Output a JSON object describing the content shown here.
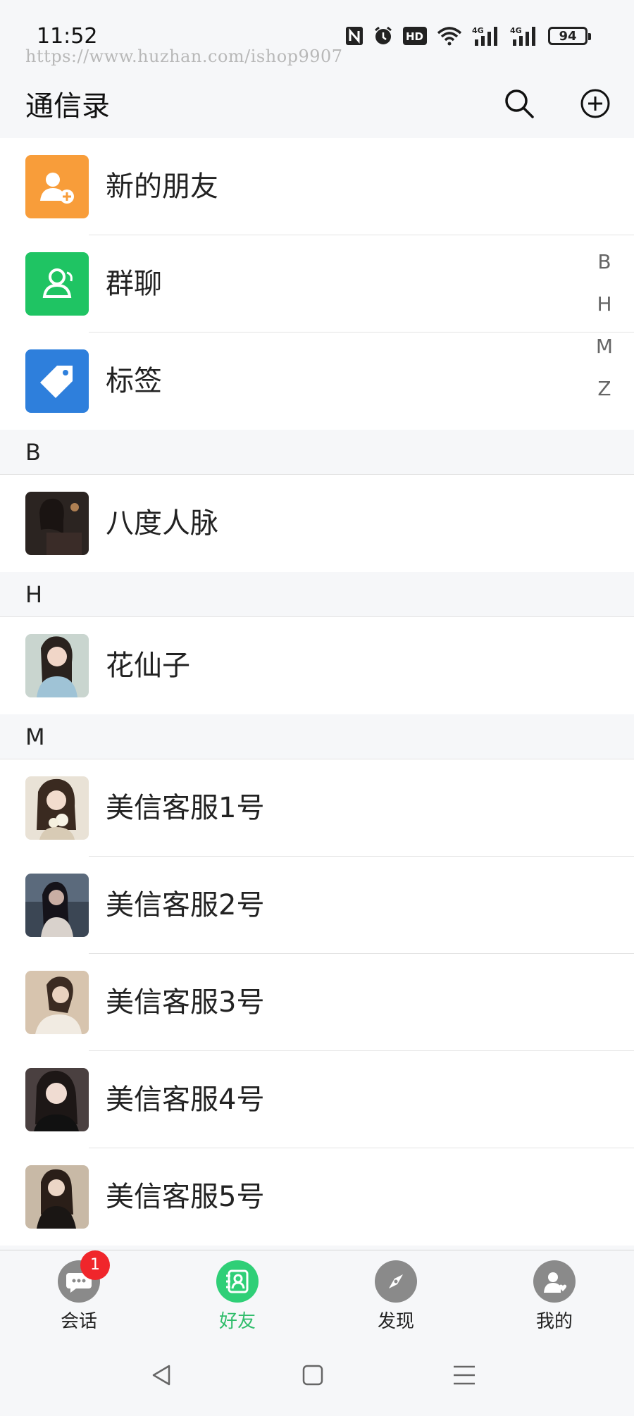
{
  "status": {
    "time": "11:52",
    "battery": "94",
    "watermark": "https://www.huzhan.com/ishop9907",
    "icons": [
      "nfc-icon",
      "alarm-icon",
      "hd-icon",
      "wifi-icon",
      "4g-signal-icon",
      "4g-signal-icon",
      "battery-icon"
    ]
  },
  "header": {
    "title": "通信录",
    "search_icon": "search-icon",
    "add_icon": "add-circle-icon"
  },
  "functions": [
    {
      "label": "新的朋友",
      "icon": "add-user-icon",
      "color": "#f89d3a"
    },
    {
      "label": "群聊",
      "icon": "group-icon",
      "color": "#1fc463"
    },
    {
      "label": "标签",
      "icon": "tag-icon",
      "color": "#2e7fdc"
    }
  ],
  "sections": [
    {
      "letter": "B",
      "contacts": [
        {
          "name": "八度人脉"
        }
      ]
    },
    {
      "letter": "H",
      "contacts": [
        {
          "name": "花仙子"
        }
      ]
    },
    {
      "letter": "M",
      "contacts": [
        {
          "name": "美信客服1号"
        },
        {
          "name": "美信客服2号"
        },
        {
          "name": "美信客服3号"
        },
        {
          "name": "美信客服4号"
        },
        {
          "name": "美信客服5号"
        }
      ]
    }
  ],
  "index_letters": [
    "B",
    "H",
    "M",
    "Z"
  ],
  "tabs": [
    {
      "label": "会话",
      "icon": "chat-icon",
      "badge": "1",
      "active": false
    },
    {
      "label": "好友",
      "icon": "contacts-icon",
      "active": true
    },
    {
      "label": "发现",
      "icon": "compass-icon",
      "active": false
    },
    {
      "label": "我的",
      "icon": "profile-icon",
      "active": false
    }
  ],
  "colors": {
    "accent": "#2fcf77",
    "badge": "#f0262b",
    "background": "#f6f7f9"
  }
}
